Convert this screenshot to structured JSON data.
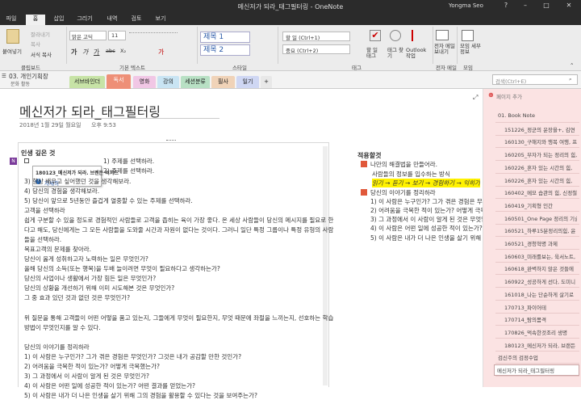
{
  "window": {
    "title": "메신저가 되라_태그필터링  -  OneNote",
    "user": "Yongma Seo",
    "help": "?",
    "minimize": "–",
    "maximize": "□",
    "close": "✕"
  },
  "menu": {
    "tabs": [
      "파일",
      "홈",
      "삽입",
      "그리기",
      "내역",
      "검토",
      "보기"
    ],
    "active_index": 1
  },
  "ribbon": {
    "clipboard": {
      "paste": "붙여넣기",
      "cut": "잘라내기",
      "copy": "복사",
      "format_painter": "서식 복사",
      "group": "클립보드"
    },
    "font": {
      "family": "맑은 고딕",
      "size": "11",
      "bold": "가",
      "italic": "가",
      "underline": "가",
      "strike": "abc",
      "sub": "X₂",
      "color": "가",
      "group": "기본 텍스트"
    },
    "styles": {
      "h1": "제목 1",
      "h2": "제목 2",
      "group": "스타일"
    },
    "tags": {
      "todo": "할 일 (Ctrl+1)",
      "important": "중요 (Ctrl+2)",
      "tag_list": "할 일 태그",
      "find_tags": "태그 찾기",
      "outlook": "Outlook 작업",
      "group": "태그"
    },
    "email": {
      "label": "전자 메일 보내기",
      "group": "전자 메일"
    },
    "meeting": {
      "label": "모임 세부 정보",
      "group": "모임"
    }
  },
  "sections": {
    "notebook": "03. 개인기획장",
    "notebook_sub": "문화 활동",
    "tabs": [
      {
        "label": "서브바인더",
        "color": "#c7e3a6"
      },
      {
        "label": "독서",
        "color": "#f7b7a7",
        "active": true
      },
      {
        "label": "영화",
        "color": "#f1c7e5"
      },
      {
        "label": "강의",
        "color": "#c9e4f3"
      },
      {
        "label": "세션분류",
        "color": "#b8e0c4"
      },
      {
        "label": "필사",
        "color": "#f0d3b8"
      },
      {
        "label": "일기",
        "color": "#cfd7f3"
      },
      {
        "label": "+",
        "color": "#e8e8e8"
      }
    ],
    "search_placeholder": "검색(Ctrl+E)"
  },
  "page": {
    "title": "메신저가 되라_태그필터링",
    "date": "2018년 1월 29일 월요일",
    "time": "오후 9:53",
    "left_heading": "인생 깊은 것",
    "popup_title": "180123_메신저가 되라. 브렌든 버처드",
    "popup_link": "자세히",
    "left_lines": [
      "1) 주제를 선택하라.",
      "2) 주제를 선택하라.",
      "3) 항상 배우고 싶어했던 것을 생각해보라.",
      "4) 당신의 경험을 생각해보라.",
      "5) 당신이 앞으로 5년동안 즐겁게 열중할 수 있는 주제를 선택하라.",
      "고객을 선택하라",
      "쉽게 구분할 수 있을 정도로 경험적인 사람들로 고객을 좁히는 육이 가장 좋다. 온 세상 사람들이 당신의 메시지를 필요로 한",
      "다고 해도, 당신에게는 그 모든 사람들을 도와줄 시간과 자원이 없다는 것이다. 그러니 일단 특정 그룹이나 특정 유형의 사람",
      "들을 선택하라.",
      "목표고객의 문제를 찾아라.",
      "당신이 옳게 성취하고자 노력하는 일은 무엇인가?",
      "올해 당신의 소득(또는 행복)을 두배 늘이려면 무엇이 필요하다고 생각하는가?",
      "당신의 사업이나 생활에서 가장 힘든 일은 무엇인가?",
      "당신의 상황을 개선하기 위해 이미 시도해본 것은 무엇인가?",
      "그 중 효과 있던 것과 없던 것은 무엇인가?",
      "",
      "위 질문을 통해 고객들이 어떤 어떻을 품고 있는지, 그들에게 무엇이 필요한지, 무엇 때문에 좌절을 느끼는지, 선호하는 학습",
      "방법이 무엇인지를 알 수 있다.",
      "",
      "당신의 이야기를 정리하라",
      "1) 이 사람은 누구인가? 그가 겪은 경험은 무엇인가? 그것은 내가 공감할 만한 것인가?",
      "2) 어려움을 극복한 적이 있는가? 어떻게 극복했는가?",
      "3) 그 과정에서 이 사람이 알게 된 것은 무엇인가?",
      "4) 이 사람은 어떤 일에 성공한 적이 있는가? 어떤 결과를 얻었는가?",
      "5) 이 사람은 내가 더 나은 인생을 살기 위해 그의 경험을 활용할 수 있다는 것을 보여주는가?"
    ],
    "right_heading": "적용할것",
    "right_lines": [
      "나만의 해결법을 만들어라.",
      "사람들의 정보를 입수하는 방식",
      "읽기 → 듣기 → 보기 → 경험하기 → 익히기",
      "당신의 이야기를 정리하라",
      "1) 이 사람은 누구인가? 그가 겪은 경험은 무엇인가?",
      "2) 어려움을 극복한 적이 있는가? 어떻게 극복했는가?",
      "3) 그 과정에서 이 사람이 알게 된 것은 무엇인가?",
      "4) 이 사람은 어떤 일에 성공한 적이 있는가? 어떤",
      "5) 이 사람은 내가 더 나은 인생을 살기 위해 그의 경"
    ],
    "highlight_color": "#fff200"
  },
  "pages_panel": {
    "add_page": "페이지 추가",
    "items": [
      "01. Book Note",
      "151226_정군의 운장을+, 김연",
      "160130_구해지와 행복 여행, 프",
      "160205_부자가 되는 정리의 힘,",
      "160226_혼자 있는 시간의 힘,",
      "160226_혼자 있는 시간의 힘,",
      "160402_메모 습관의 힘, 신정철",
      "160419_기획형 인간",
      "160501_One Page 정리의 기술",
      "160521_하루15분정리의힘, 윤",
      "160521_경청혁명 과제",
      "160603_미래를보는, 육서노트,",
      "160618_완벽하지 않은 것들에",
      "160922_성공하게 선다, 도미니",
      "161018_나는 단순하게 살기로",
      "170713_파이어테",
      "170714_탐의몸격",
      "170826_먹속한것조리 생명",
      "180123_메신저가 되라, 브랜든",
      "검신주의 검정수업",
      "메신저가 되라_태그필터링"
    ],
    "selected_index": 20
  }
}
